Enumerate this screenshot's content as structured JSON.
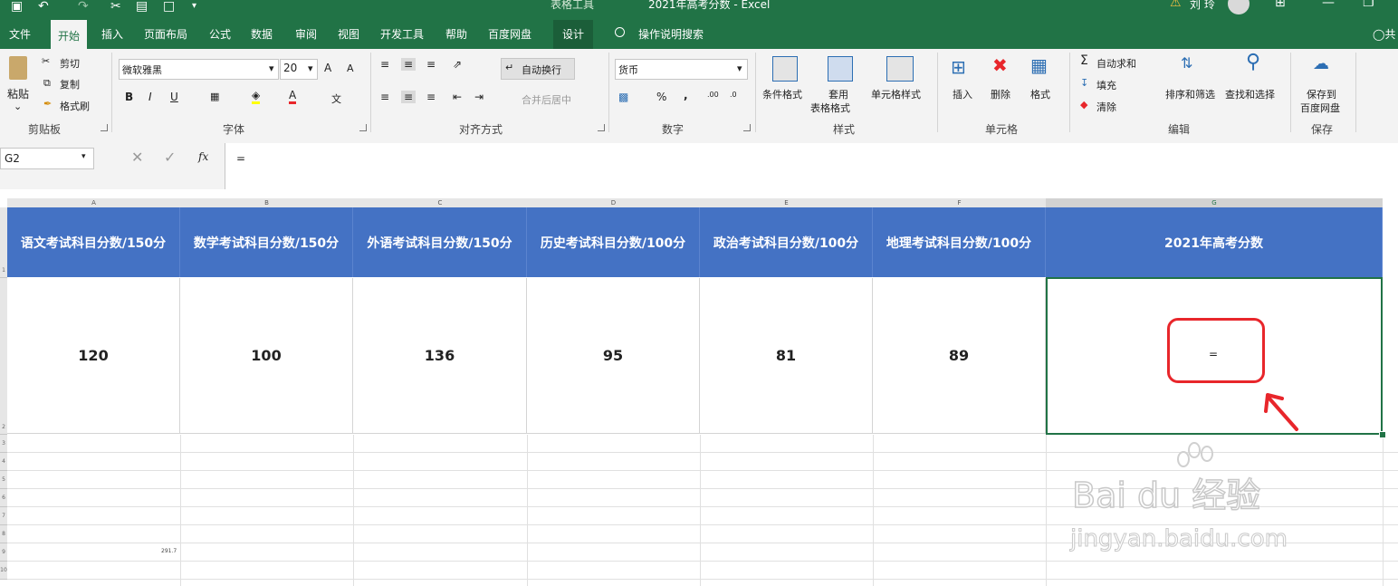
{
  "window": {
    "context_tab_group": "表格工具",
    "document_title": "2021年高考分数 - Excel",
    "user_name": "刘 玲"
  },
  "tabs": [
    "文件",
    "开始",
    "插入",
    "页面布局",
    "公式",
    "数据",
    "审阅",
    "视图",
    "开发工具",
    "帮助",
    "百度网盘",
    "设计"
  ],
  "tell_me": "操作说明搜索",
  "share_label": "共",
  "ribbon": {
    "clipboard": {
      "paste": "粘贴",
      "cut": "剪切",
      "copy": "复制",
      "format_painter": "格式刷",
      "label": "剪贴板"
    },
    "font": {
      "name": "微软雅黑",
      "size": "20",
      "bold": "B",
      "italic": "I",
      "underline": "U",
      "label": "字体",
      "grow": "A",
      "shrink": "A",
      "phonetic": "文"
    },
    "alignment": {
      "wrap_text": "自动换行",
      "merge_center": "合并后居中",
      "label": "对齐方式"
    },
    "number": {
      "format": "货币",
      "percent": "%",
      "comma": ",",
      "inc_decimal": ".00",
      "dec_decimal": ".0",
      "label": "数字"
    },
    "styles": {
      "conditional": "条件格式",
      "table_format_1": "套用",
      "table_format_2": "表格格式",
      "cell_styles": "单元格样式",
      "label": "样式"
    },
    "cells": {
      "insert": "插入",
      "delete": "删除",
      "format": "格式",
      "label": "单元格"
    },
    "editing": {
      "autosum": "自动求和",
      "fill": "填充",
      "clear": "清除",
      "sort_filter": "排序和筛选",
      "find_select": "查找和选择",
      "label": "编辑"
    },
    "save": {
      "save_baidu_1": "保存到",
      "save_baidu_2": "百度网盘",
      "label": "保存"
    }
  },
  "formula_bar": {
    "cell_ref": "G2",
    "fx": "fx",
    "content": "="
  },
  "columns": [
    "A",
    "B",
    "C",
    "D",
    "E",
    "F",
    "G"
  ],
  "rows": [
    "1",
    "2",
    "3",
    "4",
    "5",
    "6",
    "7",
    "8",
    "9",
    "10"
  ],
  "sheet": {
    "headers": [
      "语文考试科目分数/150分",
      "数学考试科目分数/150分",
      "外语考试科目分数/150分",
      "历史考试科目分数/100分",
      "政治考试科目分数/100分",
      "地理考试科目分数/100分",
      "2021年高考分数"
    ],
    "values": [
      "120",
      "100",
      "136",
      "95",
      "81",
      "89",
      "="
    ],
    "stray_value": "291.7"
  },
  "colors": {
    "excel_green": "#217346",
    "header_fill": "#4472c4",
    "highlight_red": "#e8262b"
  },
  "watermark": {
    "brand": "Bai du 经验",
    "url": "jingyan.baidu.com"
  }
}
